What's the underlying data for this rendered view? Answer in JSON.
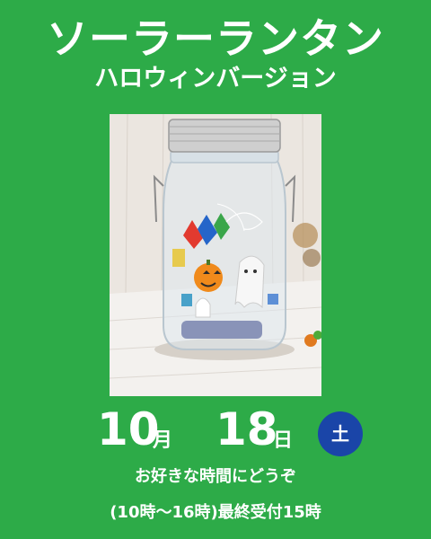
{
  "title": "ソーラーランタン",
  "subtitle": "ハロウィンバージョン",
  "date": {
    "month": "10",
    "month_unit": "月",
    "day": "18",
    "day_unit": "日",
    "weekday": "土"
  },
  "note_line1": "お好きな時間にどうぞ",
  "note_line2": "(10時〜16時)最終受付15時",
  "colors": {
    "background": "#2dab48",
    "badge": "#1a45a8",
    "text": "#ffffff"
  }
}
